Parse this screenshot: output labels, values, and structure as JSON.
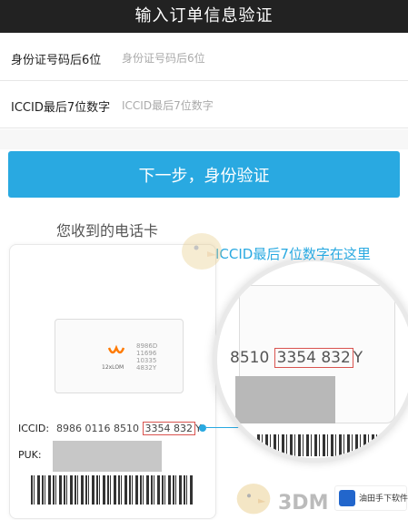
{
  "header": {
    "title": "输入订单信息验证"
  },
  "form": {
    "id_label": "身份证号码后6位",
    "id_placeholder": "身份证号码后6位",
    "iccid_label": "ICCID最后7位数字",
    "iccid_placeholder": "ICCID最后7位数字",
    "next_button": "下一步，身份验证"
  },
  "illustration": {
    "caption": "您收到的电话卡",
    "callout": "ICCID最后7位数字在这里",
    "sim_brand": "12xLOM",
    "sim_numbers": [
      "8986D",
      "11696",
      "10335",
      "4832Y"
    ],
    "iccid_label": "ICCID:",
    "iccid_prefix": "8986 0116 8510 ",
    "iccid_highlight": "3354 832",
    "iccid_suffix": "Y",
    "puk_label": "PUK:",
    "mag_prefix": "8510 ",
    "mag_highlight": "3354 832",
    "mag_suffix": "Y"
  },
  "watermark": {
    "brand": "3DM",
    "site": "油田手下软件网"
  },
  "colors": {
    "accent": "#29a9e1",
    "header_bg": "#222222",
    "highlight": "#d9534f"
  }
}
